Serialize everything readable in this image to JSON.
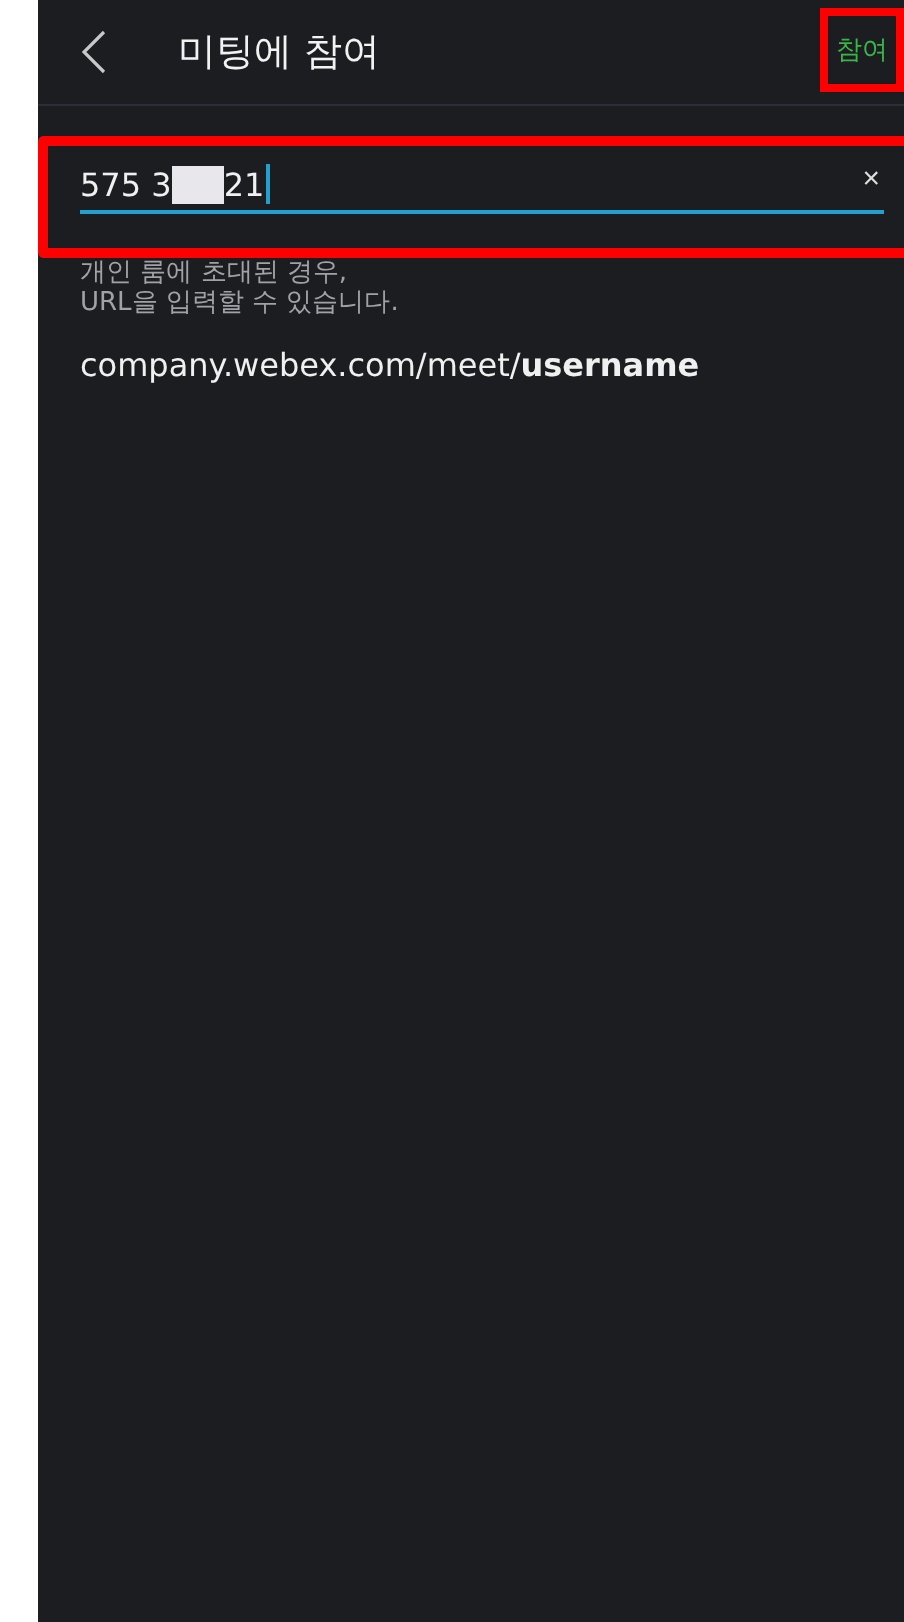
{
  "header": {
    "title": "미팅에 참여",
    "join_button": "참여"
  },
  "meeting_field": {
    "value_before": "575 3",
    "redacted": true,
    "value_after": "21",
    "clear": "×"
  },
  "hint": "개인 룸에 초대된 경우,\nURL을 입력할 수 있습니다.",
  "url_example": "company.webex.com/meet/**username**"
}
